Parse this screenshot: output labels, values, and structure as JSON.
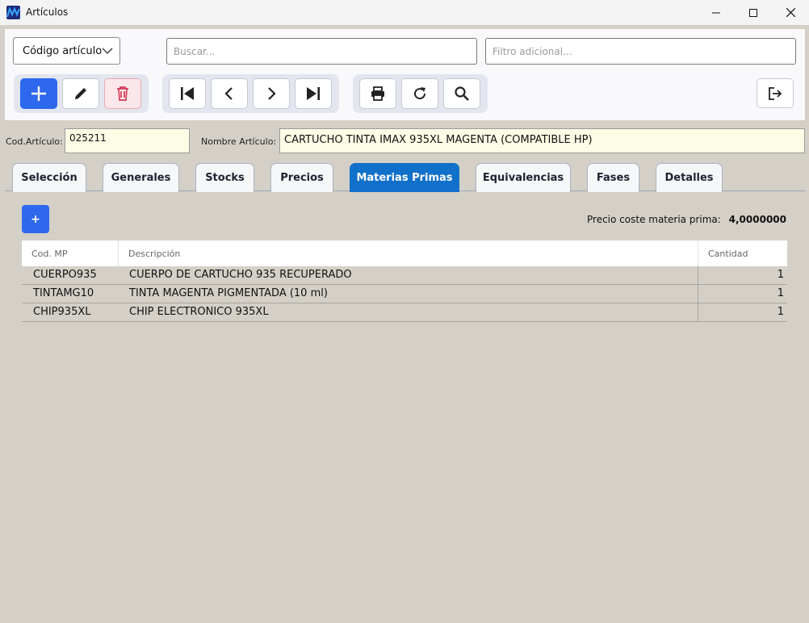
{
  "window": {
    "title": "Artículos"
  },
  "toolbar": {
    "search_mode": "Código artículo",
    "search_placeholder": "Buscar...",
    "filter_placeholder": "Filtro adicional..."
  },
  "fields": {
    "code_label": "Cod.Artículo:",
    "code_value": "025211",
    "name_label": "Nombre Artículo:",
    "name_value": "CARTUCHO TINTA IMAX 935XL MAGENTA (COMPATIBLE HP)"
  },
  "tabs": [
    {
      "label": "Selección"
    },
    {
      "label": "Generales"
    },
    {
      "label": "Stocks"
    },
    {
      "label": "Precios"
    },
    {
      "label": "Materias Primas"
    },
    {
      "label": "Equivalencias"
    },
    {
      "label": "Fases"
    },
    {
      "label": "Detalles"
    }
  ],
  "active_tab": "Materias Primas",
  "materias": {
    "add_label": "+",
    "cost_label": "Precio coste materia prima:",
    "cost_value": "4,0000000",
    "columns": [
      "Cod. MP",
      "Descripción",
      "Cantidad"
    ],
    "rows": [
      {
        "code": "CUERPO935",
        "desc": "CUERPO DE CARTUCHO 935 RECUPERADO",
        "qty": "1"
      },
      {
        "code": "TINTAMG10",
        "desc": "TINTA MAGENTA PIGMENTADA (10 ml)",
        "qty": "1"
      },
      {
        "code": "CHIP935XL",
        "desc": "CHIP ELECTRONICO 935XL",
        "qty": "1"
      }
    ]
  },
  "colors": {
    "accent": "#2e68ed",
    "active_tab": "#1170c9",
    "danger": "#d23a57",
    "window_bg": "#d4d0c8",
    "field_bg": "#fdfde6"
  },
  "icons": [
    "app-logo-icon",
    "minimize-icon",
    "maximize-icon",
    "close-icon",
    "chevron-down-icon",
    "plus-icon",
    "pencil-icon",
    "trash-icon",
    "first-record-icon",
    "previous-icon",
    "next-icon",
    "last-record-icon",
    "printer-icon",
    "refresh-icon",
    "search-icon",
    "exit-icon"
  ]
}
